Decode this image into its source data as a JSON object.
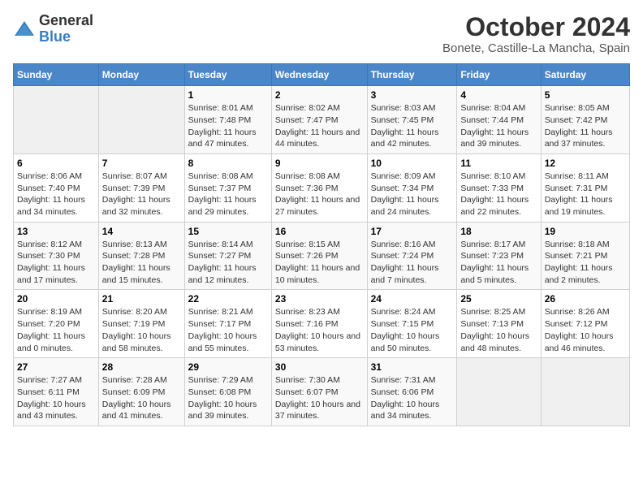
{
  "logo": {
    "general": "General",
    "blue": "Blue"
  },
  "title": "October 2024",
  "subtitle": "Bonete, Castille-La Mancha, Spain",
  "days_of_week": [
    "Sunday",
    "Monday",
    "Tuesday",
    "Wednesday",
    "Thursday",
    "Friday",
    "Saturday"
  ],
  "weeks": [
    [
      {
        "day": "",
        "empty": true
      },
      {
        "day": "",
        "empty": true
      },
      {
        "day": "1",
        "sunrise": "Sunrise: 8:01 AM",
        "sunset": "Sunset: 7:48 PM",
        "daylight": "Daylight: 11 hours and 47 minutes."
      },
      {
        "day": "2",
        "sunrise": "Sunrise: 8:02 AM",
        "sunset": "Sunset: 7:47 PM",
        "daylight": "Daylight: 11 hours and 44 minutes."
      },
      {
        "day": "3",
        "sunrise": "Sunrise: 8:03 AM",
        "sunset": "Sunset: 7:45 PM",
        "daylight": "Daylight: 11 hours and 42 minutes."
      },
      {
        "day": "4",
        "sunrise": "Sunrise: 8:04 AM",
        "sunset": "Sunset: 7:44 PM",
        "daylight": "Daylight: 11 hours and 39 minutes."
      },
      {
        "day": "5",
        "sunrise": "Sunrise: 8:05 AM",
        "sunset": "Sunset: 7:42 PM",
        "daylight": "Daylight: 11 hours and 37 minutes."
      }
    ],
    [
      {
        "day": "6",
        "sunrise": "Sunrise: 8:06 AM",
        "sunset": "Sunset: 7:40 PM",
        "daylight": "Daylight: 11 hours and 34 minutes."
      },
      {
        "day": "7",
        "sunrise": "Sunrise: 8:07 AM",
        "sunset": "Sunset: 7:39 PM",
        "daylight": "Daylight: 11 hours and 32 minutes."
      },
      {
        "day": "8",
        "sunrise": "Sunrise: 8:08 AM",
        "sunset": "Sunset: 7:37 PM",
        "daylight": "Daylight: 11 hours and 29 minutes."
      },
      {
        "day": "9",
        "sunrise": "Sunrise: 8:08 AM",
        "sunset": "Sunset: 7:36 PM",
        "daylight": "Daylight: 11 hours and 27 minutes."
      },
      {
        "day": "10",
        "sunrise": "Sunrise: 8:09 AM",
        "sunset": "Sunset: 7:34 PM",
        "daylight": "Daylight: 11 hours and 24 minutes."
      },
      {
        "day": "11",
        "sunrise": "Sunrise: 8:10 AM",
        "sunset": "Sunset: 7:33 PM",
        "daylight": "Daylight: 11 hours and 22 minutes."
      },
      {
        "day": "12",
        "sunrise": "Sunrise: 8:11 AM",
        "sunset": "Sunset: 7:31 PM",
        "daylight": "Daylight: 11 hours and 19 minutes."
      }
    ],
    [
      {
        "day": "13",
        "sunrise": "Sunrise: 8:12 AM",
        "sunset": "Sunset: 7:30 PM",
        "daylight": "Daylight: 11 hours and 17 minutes."
      },
      {
        "day": "14",
        "sunrise": "Sunrise: 8:13 AM",
        "sunset": "Sunset: 7:28 PM",
        "daylight": "Daylight: 11 hours and 15 minutes."
      },
      {
        "day": "15",
        "sunrise": "Sunrise: 8:14 AM",
        "sunset": "Sunset: 7:27 PM",
        "daylight": "Daylight: 11 hours and 12 minutes."
      },
      {
        "day": "16",
        "sunrise": "Sunrise: 8:15 AM",
        "sunset": "Sunset: 7:26 PM",
        "daylight": "Daylight: 11 hours and 10 minutes."
      },
      {
        "day": "17",
        "sunrise": "Sunrise: 8:16 AM",
        "sunset": "Sunset: 7:24 PM",
        "daylight": "Daylight: 11 hours and 7 minutes."
      },
      {
        "day": "18",
        "sunrise": "Sunrise: 8:17 AM",
        "sunset": "Sunset: 7:23 PM",
        "daylight": "Daylight: 11 hours and 5 minutes."
      },
      {
        "day": "19",
        "sunrise": "Sunrise: 8:18 AM",
        "sunset": "Sunset: 7:21 PM",
        "daylight": "Daylight: 11 hours and 2 minutes."
      }
    ],
    [
      {
        "day": "20",
        "sunrise": "Sunrise: 8:19 AM",
        "sunset": "Sunset: 7:20 PM",
        "daylight": "Daylight: 11 hours and 0 minutes."
      },
      {
        "day": "21",
        "sunrise": "Sunrise: 8:20 AM",
        "sunset": "Sunset: 7:19 PM",
        "daylight": "Daylight: 10 hours and 58 minutes."
      },
      {
        "day": "22",
        "sunrise": "Sunrise: 8:21 AM",
        "sunset": "Sunset: 7:17 PM",
        "daylight": "Daylight: 10 hours and 55 minutes."
      },
      {
        "day": "23",
        "sunrise": "Sunrise: 8:23 AM",
        "sunset": "Sunset: 7:16 PM",
        "daylight": "Daylight: 10 hours and 53 minutes."
      },
      {
        "day": "24",
        "sunrise": "Sunrise: 8:24 AM",
        "sunset": "Sunset: 7:15 PM",
        "daylight": "Daylight: 10 hours and 50 minutes."
      },
      {
        "day": "25",
        "sunrise": "Sunrise: 8:25 AM",
        "sunset": "Sunset: 7:13 PM",
        "daylight": "Daylight: 10 hours and 48 minutes."
      },
      {
        "day": "26",
        "sunrise": "Sunrise: 8:26 AM",
        "sunset": "Sunset: 7:12 PM",
        "daylight": "Daylight: 10 hours and 46 minutes."
      }
    ],
    [
      {
        "day": "27",
        "sunrise": "Sunrise: 7:27 AM",
        "sunset": "Sunset: 6:11 PM",
        "daylight": "Daylight: 10 hours and 43 minutes."
      },
      {
        "day": "28",
        "sunrise": "Sunrise: 7:28 AM",
        "sunset": "Sunset: 6:09 PM",
        "daylight": "Daylight: 10 hours and 41 minutes."
      },
      {
        "day": "29",
        "sunrise": "Sunrise: 7:29 AM",
        "sunset": "Sunset: 6:08 PM",
        "daylight": "Daylight: 10 hours and 39 minutes."
      },
      {
        "day": "30",
        "sunrise": "Sunrise: 7:30 AM",
        "sunset": "Sunset: 6:07 PM",
        "daylight": "Daylight: 10 hours and 37 minutes."
      },
      {
        "day": "31",
        "sunrise": "Sunrise: 7:31 AM",
        "sunset": "Sunset: 6:06 PM",
        "daylight": "Daylight: 10 hours and 34 minutes."
      },
      {
        "day": "",
        "empty": true
      },
      {
        "day": "",
        "empty": true
      }
    ]
  ]
}
